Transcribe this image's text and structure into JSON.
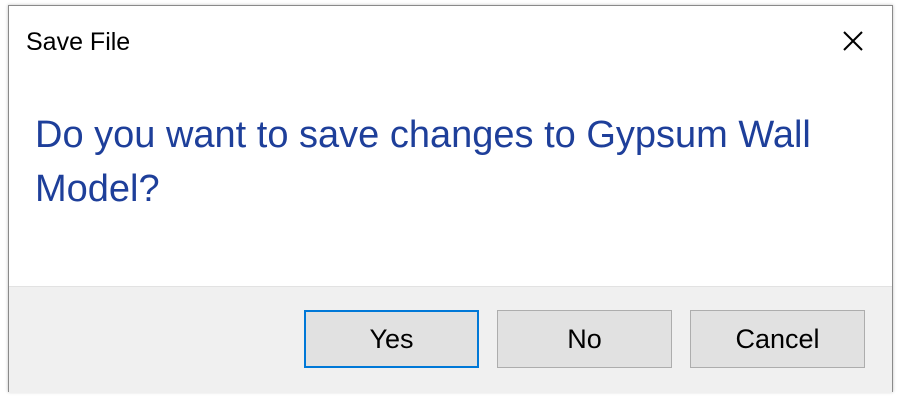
{
  "window": {
    "title": "Save File",
    "close_icon": "close-icon"
  },
  "message": "Do you want to save changes to Gypsum Wall Model?",
  "buttons": {
    "yes": "Yes",
    "no": "No",
    "cancel": "Cancel"
  },
  "colors": {
    "message_text": "#1e3f9a",
    "default_button_border": "#0078d7",
    "footer_background": "#f0f0f0",
    "button_background": "#e1e1e1"
  }
}
